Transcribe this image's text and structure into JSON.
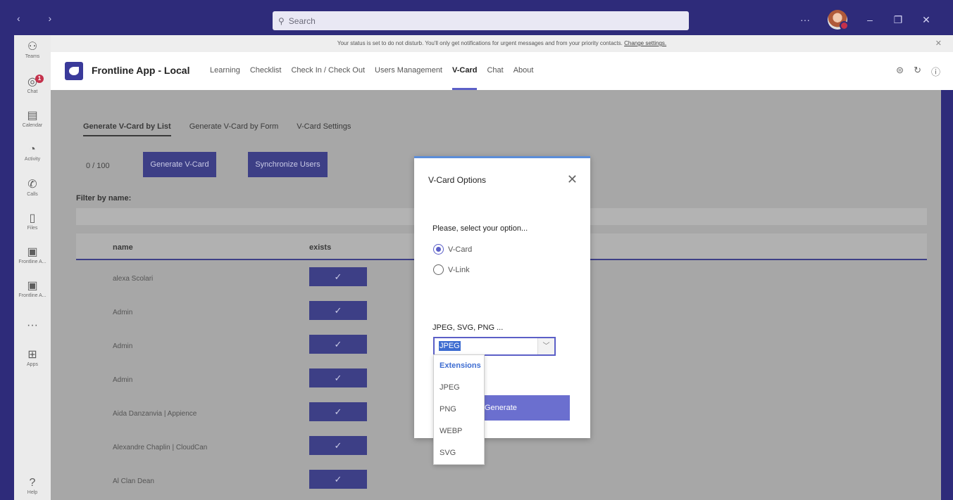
{
  "titlebar": {
    "nav": "‹ ›",
    "search_placeholder": "Search",
    "more": "···",
    "minimize": "–",
    "maximize": "❐",
    "close": "✕"
  },
  "rail": {
    "items": [
      {
        "icon": "teams-icon",
        "glyph": "⚇",
        "label": "Teams"
      },
      {
        "icon": "chat-icon",
        "glyph": "◎",
        "label": "Chat",
        "badge": "1"
      },
      {
        "icon": "calendar-icon",
        "glyph": "▤",
        "label": "Calendar"
      },
      {
        "icon": "activity-icon",
        "glyph": "◔",
        "label": "Activity"
      },
      {
        "icon": "calls-icon",
        "glyph": "✆",
        "label": "Calls"
      },
      {
        "icon": "files-icon",
        "glyph": "▯",
        "label": "Files"
      },
      {
        "icon": "frontline-app-icon",
        "glyph": "▣",
        "label": "Frontline A..."
      },
      {
        "icon": "frontline-app-icon",
        "glyph": "▣",
        "label": "Frontline A..."
      },
      {
        "icon": "more-icon",
        "glyph": "···",
        "label": ""
      },
      {
        "icon": "apps-icon",
        "glyph": "⊞",
        "label": "Apps"
      }
    ],
    "help": {
      "glyph": "?",
      "label": "Help"
    }
  },
  "banner": {
    "text": "Your status is set to do not disturb. You'll only get notifications for urgent messages and from your priority contacts.",
    "link": "Change settings."
  },
  "app": {
    "name": "Frontline App - Local",
    "tabs": [
      "Learning",
      "Checklist",
      "Check In / Check Out",
      "Users Management",
      "V-Card",
      "Chat",
      "About"
    ],
    "active_tab": "V-Card"
  },
  "vcard": {
    "subtabs": [
      "Generate V-Card by List",
      "Generate V-Card by Form",
      "V-Card Settings"
    ],
    "counter": "0 / 100",
    "generate_button": "Generate V-Card",
    "sync_button": "Synchronize Users",
    "filter_label": "Filter by name:",
    "columns": [
      "name",
      "exists"
    ],
    "rows": [
      {
        "name": "alexa Scolari",
        "check": "✓"
      },
      {
        "name": "Admin",
        "check": "✓"
      },
      {
        "name": "Admin",
        "check": "✓"
      },
      {
        "name": "Admin",
        "check": "✓"
      },
      {
        "name": "Aida Danzanvia | Appience",
        "check": "✓"
      },
      {
        "name": "Alexandre Chaplin | CloudCan",
        "check": "✓"
      },
      {
        "name": "Al Clan Dean",
        "check": "✓"
      }
    ]
  },
  "modal": {
    "title": "V-Card Options",
    "close": "✕",
    "prompt": "Please, select your option...",
    "options": [
      {
        "label": "V-Card",
        "selected": true
      },
      {
        "label": "V-Link",
        "selected": false
      }
    ],
    "format_label": "JPEG, SVG, PNG ...",
    "selected_format": "JPEG",
    "chevron": "﹀",
    "generate_button": "Generate",
    "dropdown": {
      "header": "Extensions",
      "items": [
        "JPEG",
        "PNG",
        "WEBP",
        "SVG"
      ]
    }
  },
  "colors": {
    "frame": "#2e2b7a",
    "accent": "#5b5fc7",
    "button_dark": "#3d3f86"
  }
}
